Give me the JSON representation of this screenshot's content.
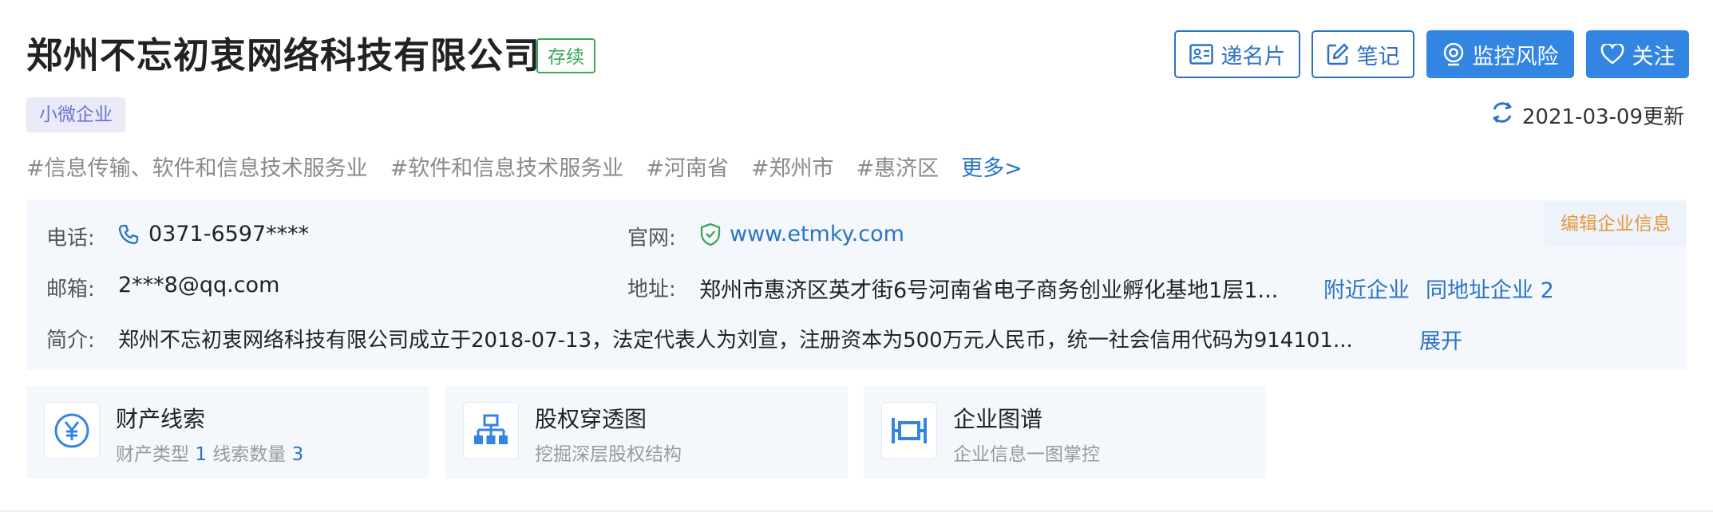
{
  "company": {
    "name": "郑州不忘初衷网络科技有限公司",
    "status": "存续",
    "scale": "小微企业",
    "updated": "2021-03-09更新"
  },
  "actions": {
    "card": "递名片",
    "note": "笔记",
    "monitor": "监控风险",
    "follow": "关注"
  },
  "tags": [
    "#信息传输、软件和信息技术服务业",
    "#软件和信息技术服务业",
    "#河南省",
    "#郑州市",
    "#惠济区"
  ],
  "tags_more": "更多>",
  "info": {
    "edit": "编辑企业信息",
    "phone_label": "电话:",
    "phone": "0371-6597****",
    "website_label": "官网:",
    "website": "www.etmky.com",
    "email_label": "邮箱:",
    "email": "2***8@qq.com",
    "address_label": "地址:",
    "address": "郑州市惠济区英才街6号河南省电子商务创业孵化基地1层1...",
    "nearby": "附近企业",
    "same_address": "同地址企业",
    "same_address_count": "2",
    "intro_label": "简介:",
    "intro": "郑州不忘初衷网络科技有限公司成立于2018-07-13，法定代表人为刘宣，注册资本为500万元人民币，统一社会信用代码为914101...",
    "expand": "展开"
  },
  "cards": [
    {
      "title": "财产线索",
      "sub_a": "财产类型",
      "num_a": "1",
      "sub_b": "线索数量",
      "num_b": "3",
      "icon": "yen-icon"
    },
    {
      "title": "股权穿透图",
      "sub": "挖掘深层股权结构",
      "icon": "org-chart-icon"
    },
    {
      "title": "企业图谱",
      "sub": "企业信息一图掌控",
      "icon": "graph-icon"
    }
  ],
  "colors": {
    "accent": "#3385e3",
    "link": "#2b73c4",
    "status_green": "#3ca65a",
    "edit_orange": "#e39a3b"
  }
}
